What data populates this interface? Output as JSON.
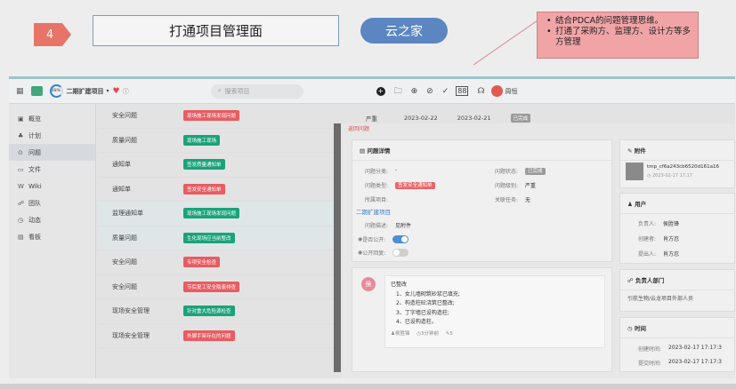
{
  "slide": {
    "step_number": "4",
    "title": "打通项目管理面",
    "brand": "云之家",
    "notes": [
      "结合PDCA的问题管理思维。",
      "打通了采购方、监理方、设计方等多方管理"
    ]
  },
  "topbar": {
    "progress": "48%",
    "project_name": "二期扩建项目",
    "search_placeholder": "搜索项目",
    "user_name": "周恒"
  },
  "sidebar": {
    "items": [
      {
        "icon": "overview-icon",
        "label": "概览"
      },
      {
        "icon": "plan-icon",
        "label": "计划"
      },
      {
        "icon": "issue-icon",
        "label": "问题"
      },
      {
        "icon": "folder-icon",
        "label": "文件"
      },
      {
        "icon": "wiki-icon",
        "label": "Wiki"
      },
      {
        "icon": "team-icon",
        "label": "团队"
      },
      {
        "icon": "activity-icon",
        "label": "动态"
      },
      {
        "icon": "board-icon",
        "label": "看板"
      }
    ]
  },
  "issues": [
    {
      "name": "安全问题",
      "tag": "现场施工现场发现问题",
      "tag_color": "#e85c62"
    },
    {
      "name": "质量问题",
      "tag": "现场施工现场",
      "tag_color": "#1aa37a"
    },
    {
      "name": "通知单",
      "tag": "签发质量通知单",
      "tag_color": "#1aa37a"
    },
    {
      "name": "通知单",
      "tag": "签发安全通知单",
      "tag_color": "#e85c62"
    },
    {
      "name": "监理通知单",
      "tag": "现场施工现场发现问题",
      "tag_color": "#1aa37a"
    },
    {
      "name": "质量问题",
      "tag": "生化现场应当前整改",
      "tag_color": "#1aa37a"
    },
    {
      "name": "安全问题",
      "tag": "专项安全检查",
      "tag_color": "#e85c62"
    },
    {
      "name": "安全问题",
      "tag": "节后复工安全隐患排查",
      "tag_color": "#e85c62"
    },
    {
      "name": "现场安全管理",
      "tag": "针对重大危险源检查",
      "tag_color": "#1aa37a"
    },
    {
      "name": "现场安全管理",
      "tag": "外脚手架存在的问题",
      "tag_color": "#e85c62"
    }
  ],
  "detail_strip": {
    "severity": "严重",
    "start_date": "2023-02-22",
    "end_date": "2023-02-21",
    "status": "已完成",
    "sub_link": "返回问题"
  },
  "issue_detail": {
    "header": "问题详情",
    "category_label": "问题分类:",
    "category_value": "-",
    "status_label": "问题状态:",
    "status_value": "已完成",
    "type_label": "问题类型:",
    "type_value": "签发安全通知单",
    "level_label": "问题级别:",
    "level_value": "严重",
    "project_label": "所属项目:",
    "related_label": "关联任务:",
    "related_value": "无",
    "section": "二期扩建项目",
    "desc_label": "问题描述:",
    "desc_value": "见附件",
    "public_label": "是否公开:",
    "archive_label": "公开回复:"
  },
  "comment": {
    "avatar": "侯",
    "title": "已整改",
    "lines": [
      "1、女儿墙砌筑砂浆已填充;",
      "2、构造柱砼浇筑已整改;",
      "3、丁字墙已设构造柱;",
      "4、已设构造柱。"
    ],
    "author": "侯胜锋",
    "time": "3分钟前",
    "count": "5"
  },
  "attachments": {
    "header": "附件",
    "file_name": "tmp_cf6a243cb6520d161a16",
    "file_date": "2023-02-17 17:17"
  },
  "users": {
    "header": "用户",
    "rows": [
      {
        "label": "负责人:",
        "value": "侯胜锋"
      },
      {
        "label": "创建者:",
        "value": "肖方忍"
      },
      {
        "label": "提出人:",
        "value": "肖方忍"
      }
    ]
  },
  "dept": {
    "header": "负责人部门",
    "value": "引航生物/云龙项目外部人员"
  },
  "time": {
    "header": "时间",
    "created_label": "创建时间:",
    "created_value": "2023-02-17 17:17:3",
    "submitted_label": "提交时间:",
    "submitted_value": "2023-02-17 17:17:3"
  }
}
